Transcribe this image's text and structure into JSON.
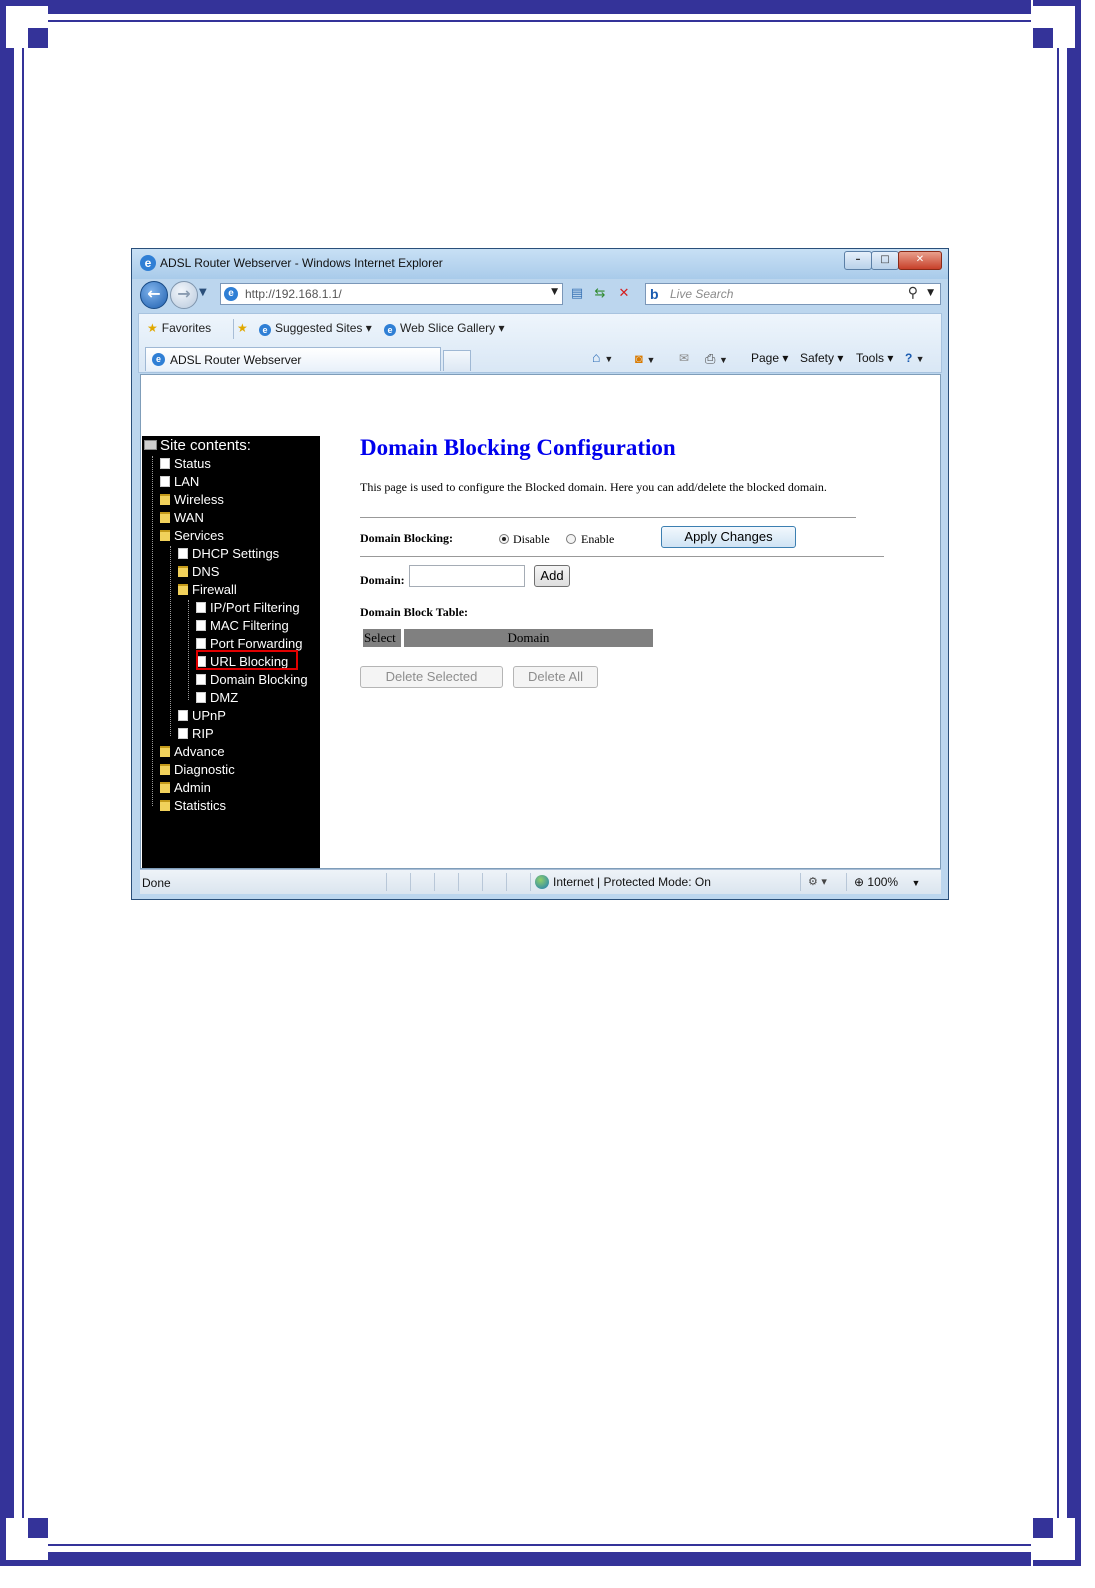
{
  "browser": {
    "window_title": "ADSL Router Webserver - Windows Internet Explorer",
    "address_url": "http://192.168.1.1/",
    "search_placeholder": "Live Search",
    "favorites_label": "Favorites",
    "suggested_sites_label": "Suggested Sites ▾",
    "web_slice_label": "Web Slice Gallery ▾",
    "tab_title": "ADSL Router Webserver",
    "page_menu": "Page ▾",
    "safety_menu": "Safety ▾",
    "tools_menu": "Tools ▾",
    "status_text": "Done",
    "status_zone": "Internet | Protected Mode: On",
    "zoom_level": "100%"
  },
  "sidebar": {
    "root_label": "Site contents:",
    "items": [
      {
        "label": "Status",
        "icon": "doc",
        "level": 0
      },
      {
        "label": "LAN",
        "icon": "doc",
        "level": 0
      },
      {
        "label": "Wireless",
        "icon": "folder",
        "level": 0
      },
      {
        "label": "WAN",
        "icon": "folder",
        "level": 0
      },
      {
        "label": "Services",
        "icon": "folder-open",
        "level": 0
      },
      {
        "label": "DHCP Settings",
        "icon": "doc",
        "level": 1
      },
      {
        "label": "DNS",
        "icon": "folder",
        "level": 1
      },
      {
        "label": "Firewall",
        "icon": "folder-open",
        "level": 1
      },
      {
        "label": "IP/Port Filtering",
        "icon": "doc",
        "level": 2
      },
      {
        "label": "MAC Filtering",
        "icon": "doc",
        "level": 2
      },
      {
        "label": "Port Forwarding",
        "icon": "doc",
        "level": 2
      },
      {
        "label": "URL Blocking",
        "icon": "doc",
        "level": 2
      },
      {
        "label": "Domain Blocking",
        "icon": "doc",
        "level": 2
      },
      {
        "label": "DMZ",
        "icon": "doc",
        "level": 2
      },
      {
        "label": "UPnP",
        "icon": "doc",
        "level": 1
      },
      {
        "label": "RIP",
        "icon": "doc",
        "level": 1
      },
      {
        "label": "Advance",
        "icon": "folder",
        "level": 0
      },
      {
        "label": "Diagnostic",
        "icon": "folder",
        "level": 0
      },
      {
        "label": "Admin",
        "icon": "folder",
        "level": 0
      },
      {
        "label": "Statistics",
        "icon": "folder",
        "level": 0
      }
    ]
  },
  "content": {
    "title": "Domain Blocking Configuration",
    "description": "This page is used to configure the Blocked domain. Here you can add/delete the blocked domain.",
    "domain_blocking_label": "Domain Blocking:",
    "radio_disable": "Disable",
    "radio_enable": "Enable",
    "selected_mode": "Disable",
    "apply_button": "Apply Changes",
    "domain_label": "Domain:",
    "domain_value": "",
    "add_button": "Add",
    "table_title": "Domain Block Table:",
    "table_columns": [
      "Select",
      "Domain"
    ],
    "delete_selected_button": "Delete Selected",
    "delete_all_button": "Delete All"
  },
  "colors": {
    "frame": "#343399",
    "title_link": "#0000ee",
    "highlight": "#e00000",
    "table_header": "#808080"
  }
}
